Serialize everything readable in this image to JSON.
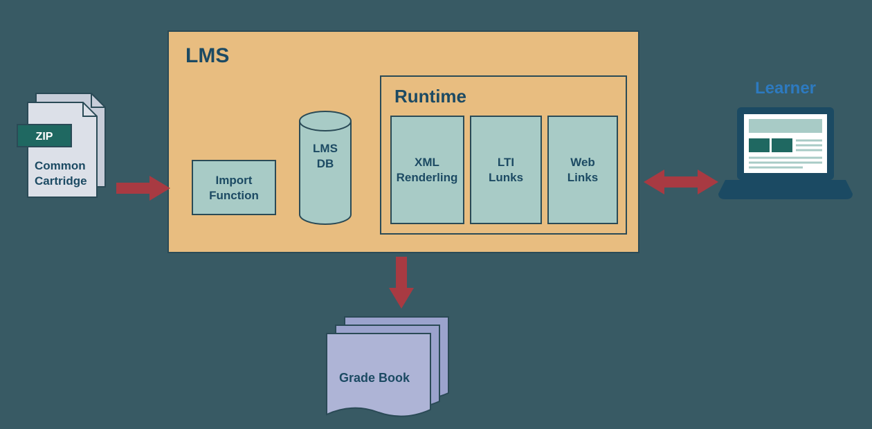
{
  "colors": {
    "bg": "#385a64",
    "lms_fill": "#e8bd80",
    "lms_stroke": "#2a4a56",
    "teal_fill": "#a8cbc6",
    "teal_stroke": "#2a4a56",
    "paper_fill": "#dce0e8",
    "paper_fill2": "#c7cdd9",
    "zip_badge": "#1f6861",
    "arrow": "#a83a42",
    "learner_text": "#2d7ac0",
    "laptop_dark": "#1b4a63",
    "grade_fill": "#aeb4d6",
    "grade_fill2": "#9ba3cd"
  },
  "zip": {
    "badge": "ZIP",
    "label1": "Common",
    "label2": "Cartridge"
  },
  "lms": {
    "title": "LMS"
  },
  "import_fn": {
    "line1": "Import",
    "line2": "Function"
  },
  "db": {
    "line1": "LMS",
    "line2": "DB"
  },
  "runtime": {
    "title": "Runtime",
    "xml": {
      "line1": "XML",
      "line2": "Renderling"
    },
    "lti": {
      "line1": "LTI",
      "line2": "Lunks"
    },
    "web": {
      "line1": "Web",
      "line2": "Links"
    }
  },
  "learner": {
    "title": "Learner"
  },
  "gradebook": {
    "title": "Grade Book"
  }
}
